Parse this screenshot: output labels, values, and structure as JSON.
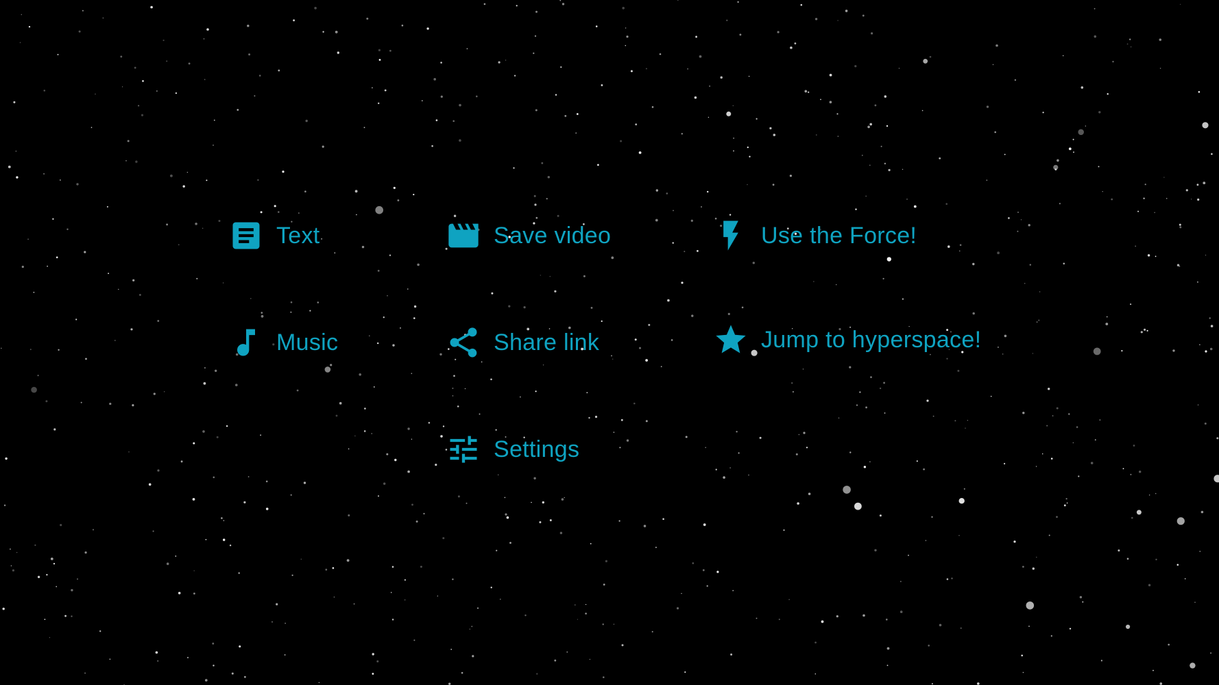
{
  "colors": {
    "accent": "#0fa3c1",
    "background": "#000000",
    "star": "#ffffff"
  },
  "menu": {
    "text": {
      "label": "Text",
      "icon": "text-document-icon"
    },
    "music": {
      "label": "Music",
      "icon": "music-note-icon"
    },
    "save_video": {
      "label": "Save video",
      "icon": "clapperboard-icon"
    },
    "share_link": {
      "label": "Share link",
      "icon": "share-icon"
    },
    "settings": {
      "label": "Settings",
      "icon": "sliders-icon"
    },
    "use_force": {
      "label": "Use the Force!",
      "icon": "lightning-bolt-icon"
    },
    "hyperspace": {
      "label": "Jump to hyperspace!",
      "icon": "star-icon"
    }
  }
}
